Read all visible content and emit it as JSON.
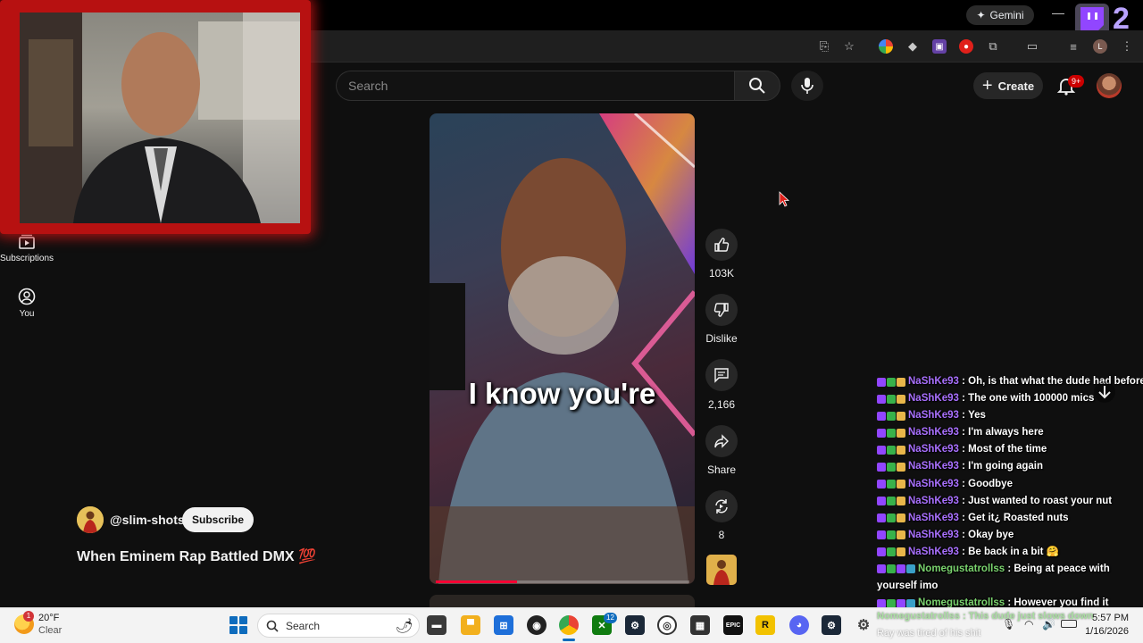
{
  "browser": {
    "gemini_label": "Gemini",
    "colors": {
      "accent": "#9146ff"
    }
  },
  "twitch_badge": {
    "number": "2"
  },
  "youtube": {
    "search": {
      "placeholder": "Search"
    },
    "create_label": "Create",
    "notifications_badge": "9+",
    "nav": [
      {
        "label": "Subscriptions",
        "icon": "subscriptions-icon"
      },
      {
        "label": "You",
        "icon": "user-circle-icon"
      }
    ],
    "video": {
      "caption": "I know you're",
      "progress": 0.32
    },
    "actions": {
      "likes": "103K",
      "dislike_label": "Dislike",
      "comments": "2,166",
      "share_label": "Share",
      "remix_count": "8"
    },
    "channel": {
      "handle": "@slim-shots",
      "subscribe_label": "Subscribe"
    },
    "title": "When Eminem Rap Battled DMX 💯"
  },
  "chat": {
    "messages": [
      {
        "user": "NaShKe93",
        "text": "Oh, is that what the dude had before?",
        "color": "purple",
        "badges": [
          "b-purple",
          "b-green",
          "b-sub"
        ]
      },
      {
        "user": "NaShKe93",
        "text": "The one with 100000 mics",
        "color": "purple",
        "badges": [
          "b-purple",
          "b-green",
          "b-sub"
        ]
      },
      {
        "user": "NaShKe93",
        "text": "Yes",
        "color": "purple",
        "badges": [
          "b-purple",
          "b-green",
          "b-sub"
        ]
      },
      {
        "user": "NaShKe93",
        "text": "I'm always here",
        "color": "purple",
        "badges": [
          "b-purple",
          "b-green",
          "b-sub"
        ]
      },
      {
        "user": "NaShKe93",
        "text": "Most of the time",
        "color": "purple",
        "badges": [
          "b-purple",
          "b-green",
          "b-sub"
        ]
      },
      {
        "user": "NaShKe93",
        "text": "I'm going again",
        "color": "purple",
        "badges": [
          "b-purple",
          "b-green",
          "b-sub"
        ]
      },
      {
        "user": "NaShKe93",
        "text": "Goodbye",
        "color": "purple",
        "badges": [
          "b-purple",
          "b-green",
          "b-sub"
        ]
      },
      {
        "user": "NaShKe93",
        "text": "Just wanted to roast your nut",
        "color": "purple",
        "badges": [
          "b-purple",
          "b-green",
          "b-sub"
        ]
      },
      {
        "user": "NaShKe93",
        "text": "Get it¿ Roasted nuts",
        "color": "purple",
        "badges": [
          "b-purple",
          "b-green",
          "b-sub"
        ]
      },
      {
        "user": "NaShKe93",
        "text": "Okay bye",
        "color": "purple",
        "badges": [
          "b-purple",
          "b-green",
          "b-sub"
        ]
      },
      {
        "user": "NaShKe93",
        "text": "Be back in a bit 🤗",
        "color": "purple",
        "badges": [
          "b-purple",
          "b-green",
          "b-sub"
        ]
      },
      {
        "user": "Nomegustatrollss",
        "text": "Being at peace with yourself imo",
        "color": "green",
        "badges": [
          "b-purple",
          "b-green",
          "b-purple",
          "b-teal"
        ]
      },
      {
        "user": "Nomegustatrollss",
        "text": "However you find it",
        "color": "green",
        "badges": [
          "b-purple",
          "b-green",
          "b-purple",
          "b-teal"
        ]
      }
    ],
    "overlay_partial": [
      "Nomegustatrollss : This dude just slows down",
      "Ray was tired of his shit"
    ]
  },
  "taskbar": {
    "weather_temp": "20°F",
    "weather_desc": "Clear",
    "weather_badge": "1",
    "search_label": "Search",
    "app_badge": "12",
    "time": "5:57 PM",
    "date": "1/16/2026"
  }
}
